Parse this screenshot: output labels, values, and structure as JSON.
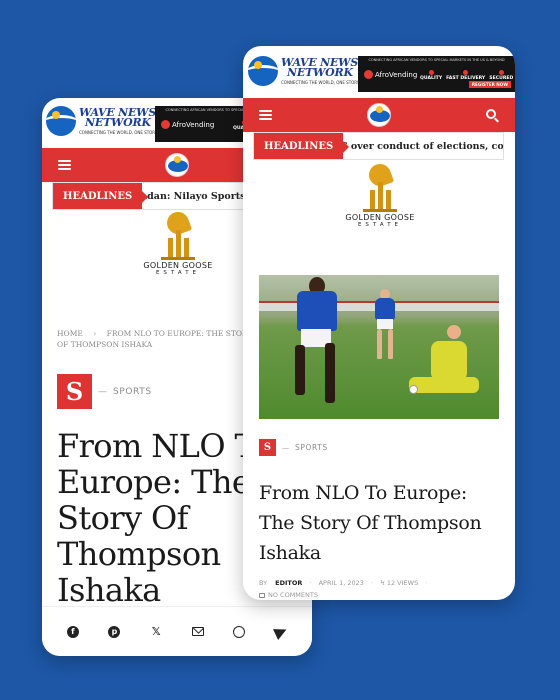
{
  "site": {
    "name_line1": "WAVE NEWS",
    "name_line2": "NETWORK",
    "tagline": "CONNECTING THE WORLD, ONE STORY AT A TIME"
  },
  "ad": {
    "top_text": "CONNECTING AFRICAN VENDORS TO SPECIAL MARKETS IN THE US & BEYOND",
    "brand": "AfroVending",
    "features": [
      "QUALITY",
      "FAST DELIVERY",
      "SECURED"
    ],
    "cta": "REGISTER NOW"
  },
  "ticker": {
    "label": "HEADLINES",
    "back_text": "adan: Nilayo Sports Management",
    "front_text": "C over conduct of elections, congratulates"
  },
  "sponsor": {
    "name": "GOLDEN GOOSE",
    "sub": "ESTATE"
  },
  "breadcrumb": {
    "home": "HOME",
    "current": "FROM NLO TO EUROPE: THE STORY OF THOMPSON ISHAKA"
  },
  "article": {
    "category_letter": "S",
    "category": "SPORTS",
    "title": "From NLO To Europe: The Story Of Thompson Ishaka",
    "by_label": "BY",
    "author": "EDITOR",
    "date": "APRIL 1, 2023",
    "views": "12 VIEWS",
    "comments": "NO COMMENTS"
  },
  "share": [
    "facebook",
    "pinterest",
    "twitter",
    "email",
    "whatsapp",
    "telegram"
  ],
  "colors": {
    "background": "#1d57a6",
    "accent": "#dd3333",
    "gold": "#e0a21a"
  }
}
